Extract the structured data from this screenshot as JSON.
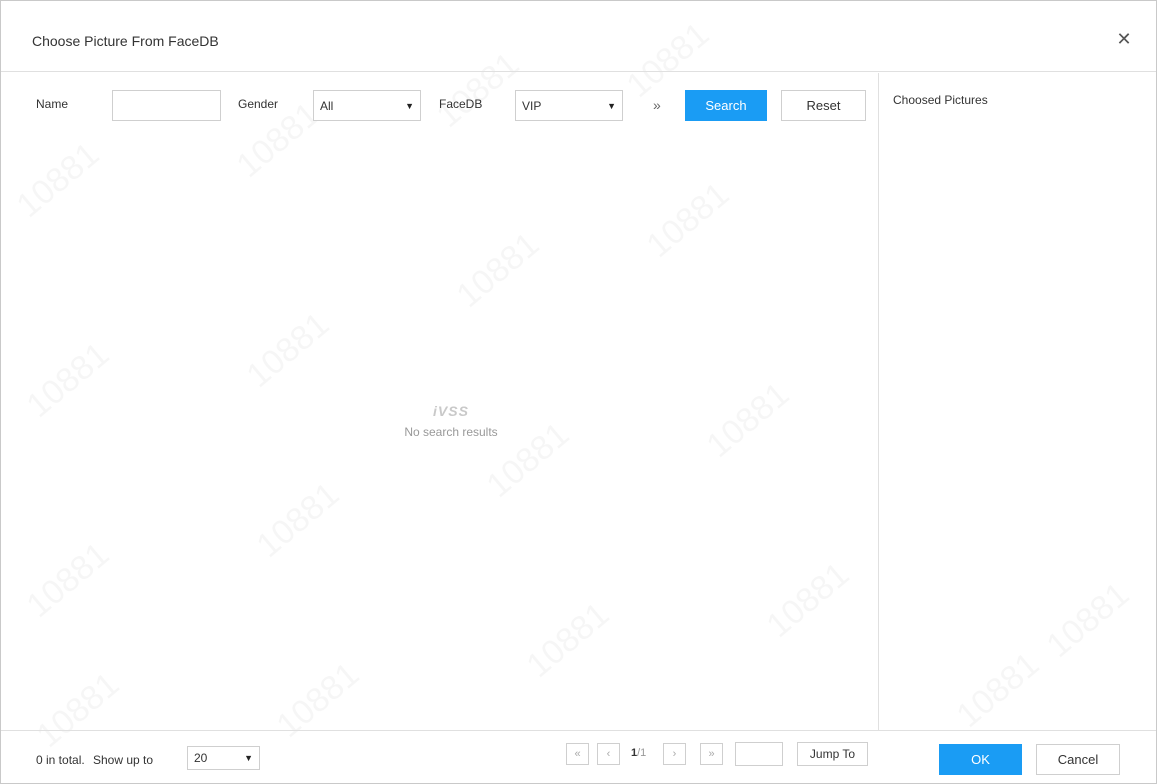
{
  "dialog": {
    "title": "Choose Picture From FaceDB"
  },
  "filters": {
    "name_label": "Name",
    "name_value": "",
    "gender_label": "Gender",
    "gender_value": "All",
    "facedb_label": "FaceDB",
    "facedb_value": "VIP",
    "search_label": "Search",
    "reset_label": "Reset"
  },
  "results": {
    "logo_text": "iVSS",
    "empty_message": "No search results"
  },
  "chosen": {
    "title": "Choosed Pictures"
  },
  "footer": {
    "total_text": "0 in total.",
    "show_up_to_label": "Show up to",
    "page_size_value": "20",
    "current_page": "1",
    "total_pages": "/1",
    "jump_to_value": "",
    "jump_to_label": "Jump To",
    "ok_label": "OK",
    "cancel_label": "Cancel"
  },
  "watermark_text": "10881",
  "colors": {
    "accent": "#1a9cf4",
    "border": "#cfcfcf"
  },
  "icons": {
    "close": "close-icon",
    "more": "double-chevron-right-icon",
    "first": "double-chevron-left-icon",
    "prev": "chevron-left-icon",
    "next": "chevron-right-icon",
    "last": "double-chevron-right-icon"
  }
}
